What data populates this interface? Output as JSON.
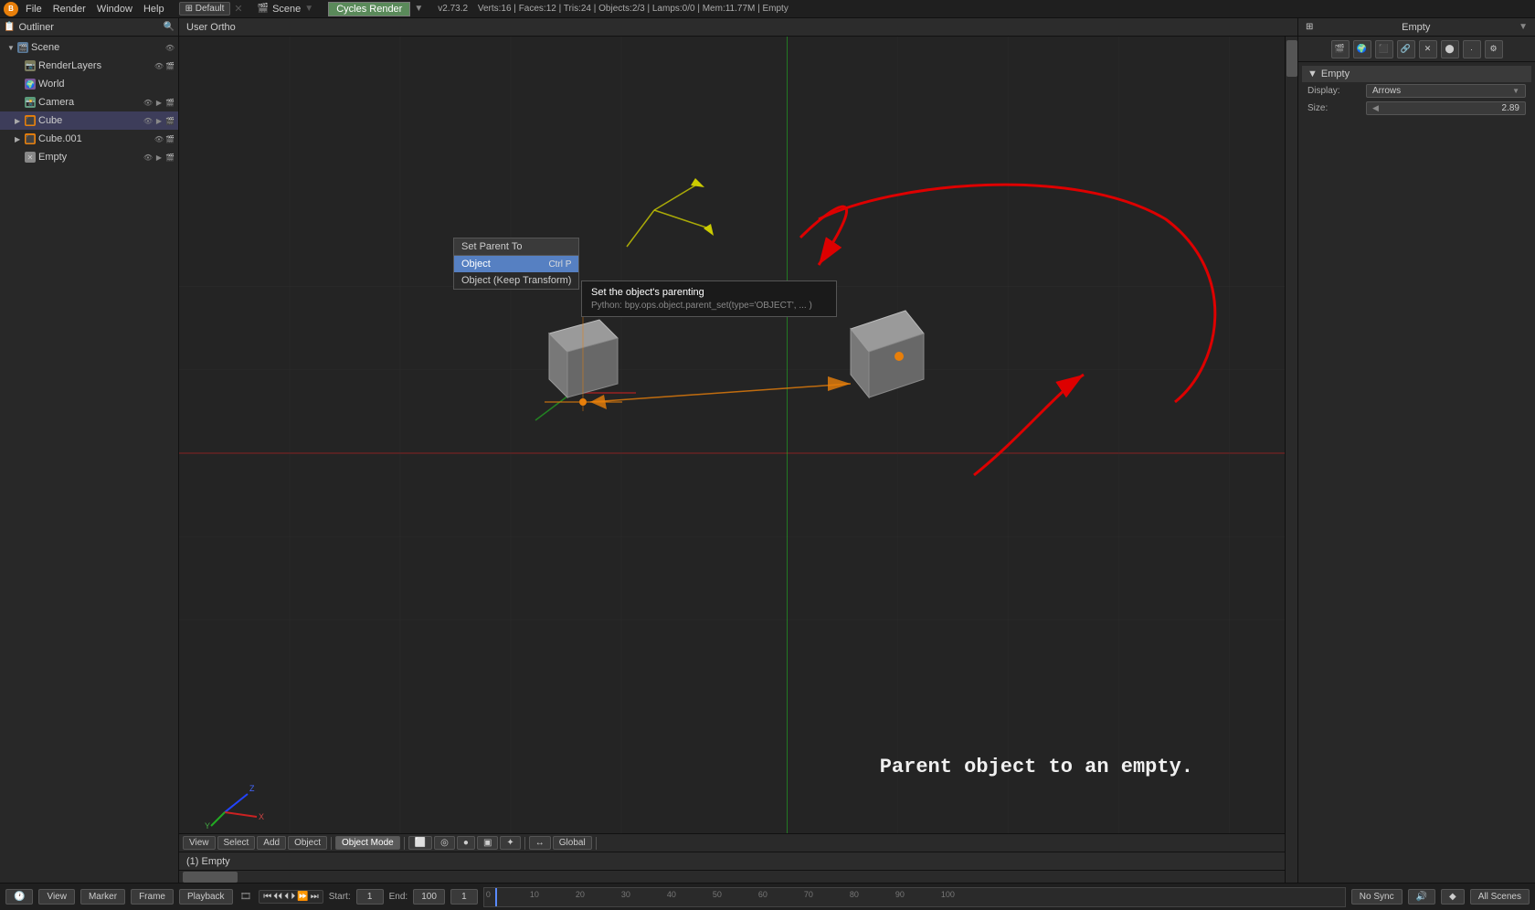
{
  "app": {
    "version": "v2.73.2",
    "stats": "Verts:16 | Faces:12 | Tris:24 | Objects:2/3 | Lamps:0/0 | Mem:11.77M | Empty"
  },
  "top_bar": {
    "menu": [
      "File",
      "Render",
      "Window",
      "Help"
    ],
    "editor_type": "Default",
    "scene_name": "Scene",
    "render_engine": "Cycles Render",
    "layout": "Default"
  },
  "outliner": {
    "title": "Outliner",
    "items": [
      {
        "label": "Scene",
        "icon": "scene",
        "indent": 0,
        "expanded": true
      },
      {
        "label": "RenderLayers",
        "icon": "renderlayers",
        "indent": 1
      },
      {
        "label": "World",
        "icon": "world",
        "indent": 1
      },
      {
        "label": "Camera",
        "icon": "camera",
        "indent": 1
      },
      {
        "label": "Cube",
        "icon": "cube",
        "indent": 1
      },
      {
        "label": "Cube.001",
        "icon": "cube2",
        "indent": 1
      },
      {
        "label": "Empty",
        "icon": "empty",
        "indent": 1
      }
    ]
  },
  "viewport": {
    "header_label": "User Ortho",
    "status_label": "(1) Empty"
  },
  "toolbar_bottom": {
    "buttons": [
      "View",
      "Select",
      "Add",
      "Object"
    ],
    "mode": "Object Mode",
    "pivot": "Global",
    "view_buttons": [
      "View",
      "Select",
      "Add",
      "Object"
    ]
  },
  "context_menu": {
    "title": "Set Parent To",
    "items": [
      {
        "label": "Object",
        "shortcut": "Ctrl P",
        "active": true
      },
      {
        "label": "Object (Keep Transform)",
        "shortcut": "",
        "active": false
      }
    ],
    "tooltip": {
      "title": "Set the object's parenting",
      "python": "Python: bpy.ops.object.parent_set(type='OBJECT', ... )"
    }
  },
  "properties_panel": {
    "title": "Empty",
    "section_title": "Empty",
    "display_label": "Display:",
    "display_value": "Arrows",
    "size_label": "Size:",
    "size_value": "2.89"
  },
  "annotation": {
    "text": "Parent object to an empty."
  },
  "bottom_bar": {
    "left_buttons": [
      "🔲",
      "View",
      "Marker",
      "Frame",
      "Playback"
    ],
    "play_controls": [
      "⏮",
      "⏪",
      "⏴",
      "⏵",
      "⏩",
      "⏭"
    ],
    "start_label": "Start:",
    "start_value": "1",
    "end_label": "End:",
    "end_value": "100",
    "frame_label": "",
    "frame_value": "1",
    "sync": "No Sync",
    "scene_label": "All Scenes",
    "timeline_marks": [
      0,
      10,
      20,
      30,
      40,
      50,
      60,
      70,
      80,
      90,
      100
    ]
  }
}
